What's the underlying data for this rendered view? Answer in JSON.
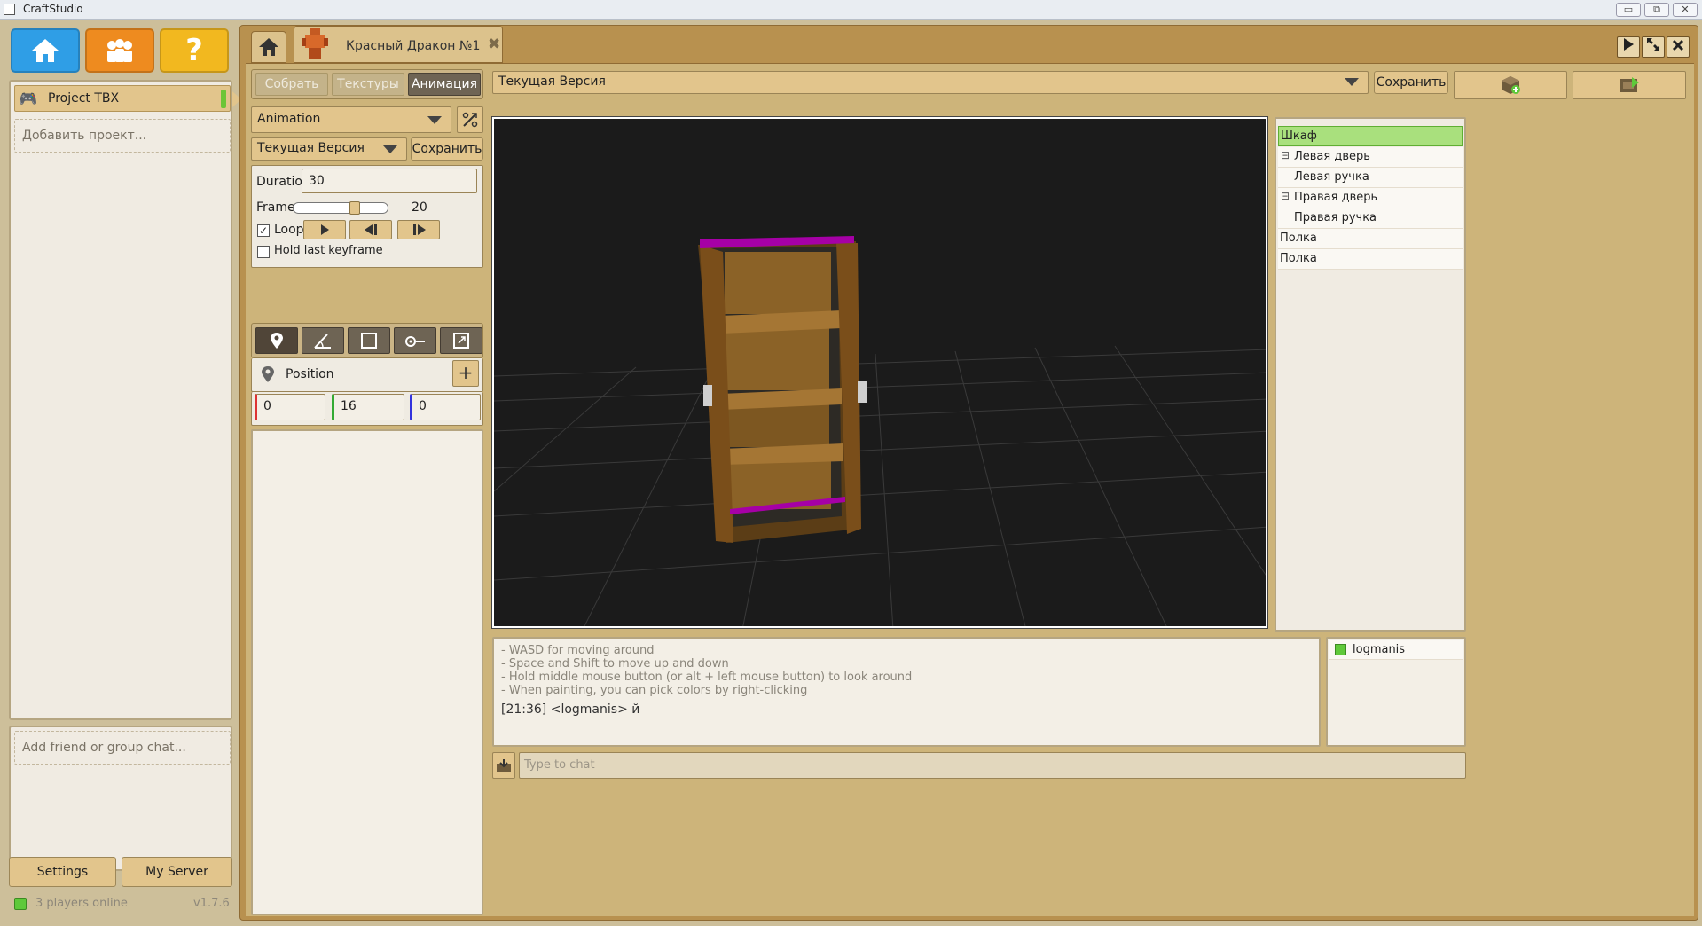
{
  "window": {
    "title": "CraftStudio",
    "min": "▭",
    "max": "⧉",
    "close": "✕"
  },
  "left": {
    "project": {
      "name": "Project TBX"
    },
    "add_project": "Добавить проект...",
    "add_friend": "Add friend or group chat...",
    "settings_label": "Settings",
    "server_label": "My Server",
    "players_online": "3 players online",
    "version": "v1.7.6"
  },
  "tabs": {
    "doc_title": "Красный Дракон №1",
    "close": "✖"
  },
  "modes": [
    "Собрать",
    "Текстуры",
    "Анимация"
  ],
  "anim": {
    "animation_select": "Animation",
    "version_select": "Текущая Версия",
    "save_label": "Сохранить",
    "duration_label": "Duration",
    "duration_value": "30",
    "frame_label": "Frame",
    "frame_value": "20",
    "frame_fraction": 0.67,
    "loop_label": "Loop",
    "loop_checked": true,
    "hold_label": "Hold last keyframe",
    "hold_checked": false
  },
  "transform": {
    "title": "Position",
    "add": "+",
    "x": "0",
    "y": "16",
    "z": "0"
  },
  "top": {
    "version_select": "Текущая Версия",
    "save_label": "Сохранить"
  },
  "tree": {
    "items": [
      {
        "label": "Шкаф",
        "selected": true
      },
      {
        "label": "Левая дверь",
        "expander": "⊟"
      },
      {
        "label": "Левая ручка"
      },
      {
        "label": "Правая дверь",
        "expander": "⊟"
      },
      {
        "label": "Правая ручка"
      },
      {
        "label": "Полка"
      },
      {
        "label": "Полка"
      }
    ]
  },
  "chat": {
    "help": [
      "- WASD for moving around",
      "- Space and Shift to move up and down",
      "- Hold middle mouse button (or alt + left mouse button) to look around",
      "- When painting, you can pick colors by right-clicking"
    ],
    "message": "[21:36] <logmanis> й",
    "placeholder": "Type to chat"
  },
  "users": [
    {
      "name": "logmanis"
    }
  ],
  "colors": {
    "accent": "#e2c58c",
    "frame": "#b8914f",
    "online": "#5fc93a",
    "selected": "#a9e07d"
  },
  "icons": [
    "home-icon",
    "community-icon",
    "help-icon",
    "gamepad-icon",
    "play-icon",
    "fullscreen-icon",
    "close-icon",
    "position-icon",
    "rotation-icon",
    "scale-icon",
    "pivot-icon",
    "size-icon",
    "add-model-icon",
    "export-icon",
    "import-icon"
  ]
}
